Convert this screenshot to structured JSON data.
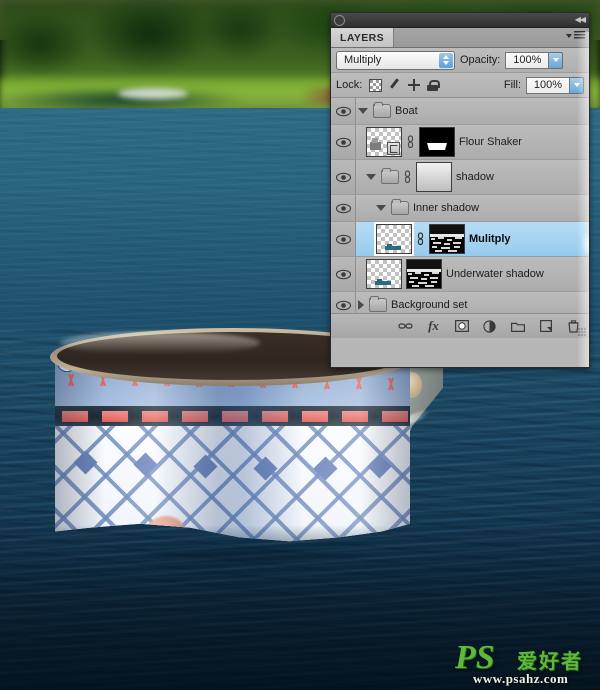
{
  "panel": {
    "titlebar": {
      "collapse_icon": "double-left-arrows"
    },
    "tab_label": "LAYERS",
    "menu_icon": "panel-menu-icon",
    "controls": {
      "blend_mode": "Multiply",
      "opacity_label": "Opacity:",
      "opacity_value": "100%",
      "lock_label": "Lock:",
      "lock_icons": [
        "lock-transparency-icon",
        "lock-image-icon",
        "lock-position-icon",
        "lock-all-icon"
      ],
      "fill_label": "Fill:",
      "fill_value": "100%"
    },
    "layers": [
      {
        "name": "Boat",
        "type": "group",
        "expanded": true,
        "indent": 0,
        "visible": true,
        "selected": false,
        "thumbs": []
      },
      {
        "name": "Flour Shaker",
        "type": "layer",
        "indent": 1,
        "visible": true,
        "selected": false,
        "thumbs": [
          "transparent-smart-object",
          "layer-mask-black"
        ]
      },
      {
        "name": "shadow",
        "type": "group",
        "expanded": true,
        "indent": 1,
        "visible": true,
        "selected": false,
        "thumbs": [
          "group-mask-gradient"
        ]
      },
      {
        "name": "Inner shadow",
        "type": "group",
        "expanded": true,
        "indent": 2,
        "visible": true,
        "selected": false,
        "thumbs": []
      },
      {
        "name": "Mulitply",
        "type": "layer",
        "indent": 2,
        "visible": true,
        "selected": true,
        "thumbs": [
          "transparent-water",
          "layer-mask-noise"
        ]
      },
      {
        "name": "Underwater shadow",
        "type": "layer",
        "indent": 2,
        "visible": true,
        "selected": false,
        "thumbs": [
          "transparent-water",
          "layer-mask-noise"
        ]
      },
      {
        "name": "Background set",
        "type": "group",
        "expanded": false,
        "indent": 0,
        "visible": true,
        "selected": false,
        "thumbs": []
      }
    ],
    "footer_buttons": [
      {
        "name": "link-layers-icon",
        "glyph": "link"
      },
      {
        "name": "layer-style-fx-icon",
        "glyph": "fx"
      },
      {
        "name": "add-layer-mask-icon",
        "glyph": "mask"
      },
      {
        "name": "adjustment-layer-icon",
        "glyph": "adjust"
      },
      {
        "name": "new-group-icon",
        "glyph": "folder"
      },
      {
        "name": "new-layer-icon",
        "glyph": "newlayer"
      },
      {
        "name": "delete-layer-icon",
        "glyph": "trash"
      }
    ]
  },
  "watermark": {
    "logo": "PS",
    "chinese": "爱好者",
    "url": "www.psahz.com"
  },
  "colors": {
    "selected_row": "#97cbee",
    "panel_bg": "#b2b2b2",
    "accent_blue": "#6aa6d6",
    "watermark_green": "#5fb83a"
  }
}
